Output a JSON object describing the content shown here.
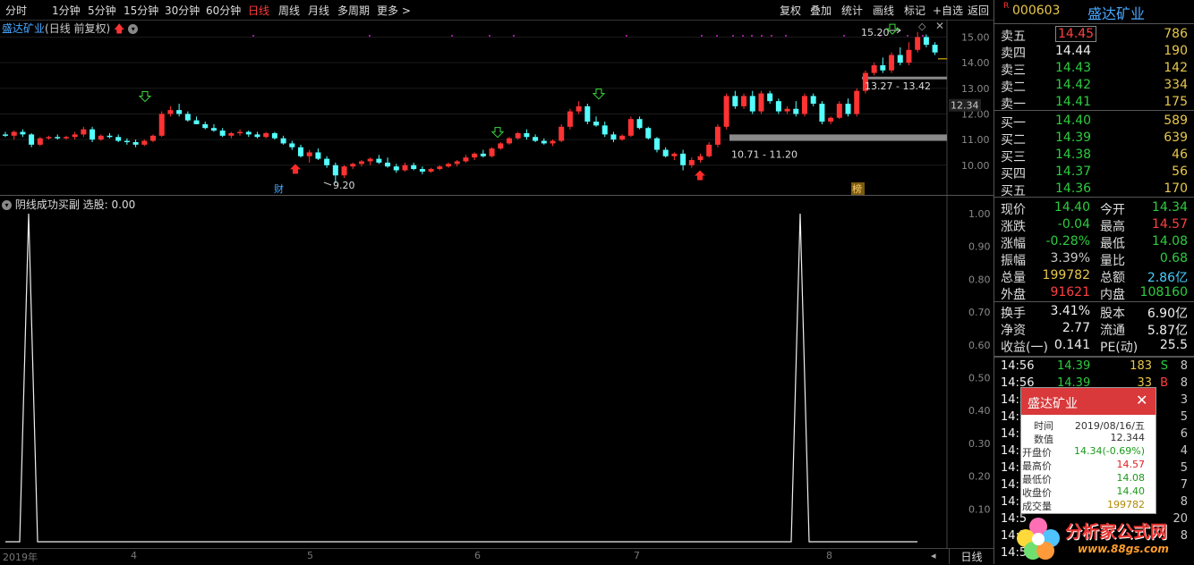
{
  "toolbar": {
    "items": [
      "分时",
      "1分钟",
      "5分钟",
      "15分钟",
      "30分钟",
      "60分钟",
      "日线",
      "周线",
      "月线",
      "多周期",
      "更多 >"
    ],
    "active": "日线",
    "right_items": [
      "复权",
      "叠加",
      "统计",
      "画线",
      "标记",
      "+自选",
      "返回"
    ]
  },
  "main_chart": {
    "title": "盛达矿业",
    "subtitle": "(日线 前复权)",
    "price_axis": [
      "15.00",
      "14.00",
      "13.00",
      "12.00",
      "11.00",
      "10.00"
    ],
    "current_price_tag": "12.34",
    "annotations": {
      "high_label": "15.20",
      "low_label": "9.20",
      "zone_upper": "13.27 - 13.42",
      "zone_lower": "10.71 - 11.20",
      "finance_mark": "财",
      "rank_mark": "榜"
    },
    "candles": [
      [
        11.2,
        11.3,
        11.1,
        11.15
      ],
      [
        11.15,
        11.35,
        11.0,
        11.3
      ],
      [
        11.3,
        11.4,
        11.1,
        11.2
      ],
      [
        11.2,
        11.25,
        10.7,
        10.8
      ],
      [
        10.8,
        11.1,
        10.75,
        11.05
      ],
      [
        11.05,
        11.15,
        11.0,
        11.1
      ],
      [
        11.1,
        11.2,
        11.0,
        11.05
      ],
      [
        11.05,
        11.15,
        11.0,
        11.1
      ],
      [
        11.1,
        11.3,
        11.0,
        11.2
      ],
      [
        11.2,
        11.5,
        11.1,
        11.4
      ],
      [
        11.4,
        11.5,
        10.9,
        11.0
      ],
      [
        11.0,
        11.2,
        10.95,
        11.15
      ],
      [
        11.15,
        11.25,
        11.05,
        11.1
      ],
      [
        11.1,
        11.2,
        10.9,
        10.95
      ],
      [
        10.95,
        11.05,
        10.8,
        10.9
      ],
      [
        10.9,
        11.0,
        10.7,
        10.8
      ],
      [
        10.8,
        11.0,
        10.75,
        10.95
      ],
      [
        10.95,
        11.2,
        10.9,
        11.15
      ],
      [
        11.15,
        12.1,
        11.1,
        12.0
      ],
      [
        12.0,
        12.3,
        11.9,
        12.15
      ],
      [
        12.15,
        12.4,
        11.9,
        12.0
      ],
      [
        12.0,
        12.1,
        11.7,
        11.75
      ],
      [
        11.75,
        11.9,
        11.6,
        11.6
      ],
      [
        11.6,
        11.7,
        11.4,
        11.45
      ],
      [
        11.45,
        11.6,
        11.3,
        11.35
      ],
      [
        11.35,
        11.45,
        11.1,
        11.15
      ],
      [
        11.15,
        11.3,
        11.05,
        11.25
      ],
      [
        11.25,
        11.4,
        11.15,
        11.3
      ],
      [
        11.3,
        11.35,
        11.1,
        11.2
      ],
      [
        11.2,
        11.3,
        11.05,
        11.1
      ],
      [
        11.1,
        11.3,
        11.05,
        11.25
      ],
      [
        11.25,
        11.3,
        11.0,
        11.05
      ],
      [
        11.05,
        11.15,
        10.8,
        10.85
      ],
      [
        10.85,
        10.95,
        10.6,
        10.7
      ],
      [
        10.7,
        10.8,
        10.3,
        10.35
      ],
      [
        10.35,
        10.6,
        10.1,
        10.5
      ],
      [
        10.5,
        10.65,
        10.2,
        10.25
      ],
      [
        10.25,
        10.35,
        9.9,
        10.0
      ],
      [
        10.0,
        10.1,
        9.3,
        9.6
      ],
      [
        9.6,
        10.0,
        9.5,
        9.95
      ],
      [
        9.95,
        10.1,
        9.85,
        10.05
      ],
      [
        10.05,
        10.2,
        9.95,
        10.15
      ],
      [
        10.15,
        10.3,
        10.0,
        10.25
      ],
      [
        10.25,
        10.4,
        10.05,
        10.1
      ],
      [
        10.1,
        10.3,
        9.9,
        9.95
      ],
      [
        9.95,
        10.05,
        9.7,
        9.8
      ],
      [
        9.8,
        10.1,
        9.75,
        10.0
      ],
      [
        10.0,
        10.1,
        9.8,
        9.85
      ],
      [
        9.85,
        9.95,
        9.65,
        9.75
      ],
      [
        9.75,
        9.9,
        9.7,
        9.85
      ],
      [
        9.85,
        10.0,
        9.8,
        9.95
      ],
      [
        9.95,
        10.1,
        9.9,
        10.05
      ],
      [
        10.05,
        10.2,
        9.95,
        10.15
      ],
      [
        10.15,
        10.4,
        10.1,
        10.3
      ],
      [
        10.3,
        10.5,
        10.2,
        10.45
      ],
      [
        10.45,
        10.6,
        10.3,
        10.35
      ],
      [
        10.35,
        10.7,
        10.3,
        10.65
      ],
      [
        10.65,
        10.9,
        10.6,
        10.85
      ],
      [
        10.85,
        11.1,
        10.8,
        11.05
      ],
      [
        11.05,
        11.3,
        11.0,
        11.25
      ],
      [
        11.25,
        11.4,
        11.0,
        11.1
      ],
      [
        11.1,
        11.2,
        10.9,
        10.95
      ],
      [
        10.95,
        11.05,
        10.8,
        10.85
      ],
      [
        10.85,
        11.0,
        10.75,
        10.95
      ],
      [
        10.95,
        11.6,
        10.9,
        11.5
      ],
      [
        11.5,
        12.2,
        11.4,
        12.1
      ],
      [
        12.1,
        12.5,
        12.0,
        12.3
      ],
      [
        12.3,
        12.4,
        11.6,
        11.7
      ],
      [
        11.7,
        11.9,
        11.5,
        11.55
      ],
      [
        11.55,
        11.7,
        11.1,
        11.2
      ],
      [
        11.2,
        11.3,
        10.9,
        11.0
      ],
      [
        11.0,
        11.2,
        10.95,
        11.15
      ],
      [
        11.15,
        11.9,
        11.1,
        11.8
      ],
      [
        11.8,
        11.9,
        11.4,
        11.45
      ],
      [
        11.45,
        11.5,
        11.0,
        11.05
      ],
      [
        11.05,
        11.1,
        10.5,
        10.6
      ],
      [
        10.6,
        10.7,
        10.3,
        10.35
      ],
      [
        10.35,
        10.5,
        10.2,
        10.45
      ],
      [
        10.45,
        10.6,
        9.8,
        10.0
      ],
      [
        10.0,
        10.3,
        9.9,
        10.2
      ],
      [
        10.2,
        10.45,
        10.1,
        10.35
      ],
      [
        10.35,
        10.9,
        10.3,
        10.8
      ],
      [
        10.8,
        11.6,
        10.7,
        11.5
      ],
      [
        11.5,
        12.8,
        11.4,
        12.7
      ],
      [
        12.7,
        12.9,
        12.2,
        12.3
      ],
      [
        12.3,
        12.8,
        12.2,
        12.7
      ],
      [
        12.7,
        12.9,
        12.0,
        12.1
      ],
      [
        12.1,
        12.9,
        12.0,
        12.8
      ],
      [
        12.8,
        12.9,
        12.4,
        12.5
      ],
      [
        12.5,
        12.6,
        12.0,
        12.1
      ],
      [
        12.1,
        12.3,
        12.0,
        12.2
      ],
      [
        12.2,
        12.5,
        11.9,
        12.0
      ],
      [
        12.0,
        12.8,
        11.9,
        12.7
      ],
      [
        12.7,
        12.8,
        12.3,
        12.4
      ],
      [
        12.4,
        12.5,
        11.6,
        11.7
      ],
      [
        11.7,
        11.9,
        11.6,
        11.85
      ],
      [
        11.85,
        12.5,
        11.8,
        12.4
      ],
      [
        12.4,
        12.6,
        11.9,
        12.0
      ],
      [
        12.0,
        13.0,
        11.9,
        12.9
      ],
      [
        12.9,
        13.7,
        12.8,
        13.6
      ],
      [
        13.6,
        14.0,
        13.5,
        13.9
      ],
      [
        13.9,
        14.2,
        13.6,
        13.7
      ],
      [
        13.7,
        14.4,
        13.6,
        14.3
      ],
      [
        14.3,
        14.6,
        13.9,
        14.0
      ],
      [
        14.0,
        14.8,
        13.9,
        14.5
      ],
      [
        14.5,
        15.2,
        14.4,
        15.0
      ],
      [
        15.0,
        15.1,
        14.6,
        14.7
      ],
      [
        14.7,
        14.8,
        14.3,
        14.4
      ]
    ]
  },
  "indicator": {
    "title": "阴线成功买副",
    "select_label": "选股: 0.00",
    "axis": [
      "1.00",
      "0.90",
      "0.80",
      "0.70",
      "0.60",
      "0.50",
      "0.40",
      "0.30",
      "0.20",
      "0.10"
    ],
    "signals": [
      {
        "index": 4,
        "value": 1.0
      },
      {
        "index": 117,
        "value": 1.0
      }
    ]
  },
  "bottom_axis": {
    "labels": [
      "2019年",
      "4",
      "5",
      "6",
      "7",
      "8"
    ],
    "period_button": "日线"
  },
  "quote_panel": {
    "code": "000603",
    "name": "盛达矿业",
    "flag": "R",
    "sell": [
      {
        "label": "卖五",
        "price": "14.45",
        "vol": "786"
      },
      {
        "label": "卖四",
        "price": "14.44",
        "vol": "190"
      },
      {
        "label": "卖三",
        "price": "14.43",
        "vol": "142"
      },
      {
        "label": "卖二",
        "price": "14.42",
        "vol": "334"
      },
      {
        "label": "卖一",
        "price": "14.41",
        "vol": "175"
      }
    ],
    "buy": [
      {
        "label": "买一",
        "price": "14.40",
        "vol": "589"
      },
      {
        "label": "买二",
        "price": "14.39",
        "vol": "639"
      },
      {
        "label": "买三",
        "price": "14.38",
        "vol": "46"
      },
      {
        "label": "买四",
        "price": "14.37",
        "vol": "56"
      },
      {
        "label": "买五",
        "price": "14.36",
        "vol": "170"
      }
    ],
    "stats": [
      {
        "l1": "现价",
        "v1": "14.40",
        "c1": "green",
        "l2": "今开",
        "v2": "14.34",
        "c2": "green"
      },
      {
        "l1": "涨跌",
        "v1": "-0.04",
        "c1": "green",
        "l2": "最高",
        "v2": "14.57",
        "c2": "red"
      },
      {
        "l1": "涨幅",
        "v1": "-0.28%",
        "c1": "green",
        "l2": "最低",
        "v2": "14.08",
        "c2": "green"
      },
      {
        "l1": "振幅",
        "v1": "3.39%",
        "c1": "gray",
        "l2": "量比",
        "v2": "0.68",
        "c2": "green"
      },
      {
        "l1": "总量",
        "v1": "199782",
        "c1": "yellow",
        "l2": "总额",
        "v2": "2.86亿",
        "c2": "cyan"
      },
      {
        "l1": "外盘",
        "v1": "91621",
        "c1": "red",
        "l2": "内盘",
        "v2": "108160",
        "c2": "green"
      }
    ],
    "fundamentals": [
      {
        "l1": "换手",
        "v1": "3.41%",
        "l2": "股本",
        "v2": "6.90亿"
      },
      {
        "l1": "净资",
        "v1": "2.77",
        "l2": "流通",
        "v2": "5.87亿"
      },
      {
        "l1": "收益(一)",
        "v1": "0.141",
        "l2": "PE(动)",
        "v2": "25.5"
      }
    ],
    "ticks": [
      {
        "time": "14:56",
        "price": "14.39",
        "vol": "183",
        "side": "S",
        "n": "8"
      },
      {
        "time": "14:56",
        "price": "14.39",
        "vol": "33",
        "side": "B",
        "n": "8"
      },
      {
        "time": "14:5",
        "price": "",
        "vol": "",
        "side": "",
        "n": "3"
      },
      {
        "time": "14:5",
        "price": "",
        "vol": "",
        "side": "",
        "n": "5"
      },
      {
        "time": "14:5",
        "price": "",
        "vol": "",
        "side": "",
        "n": "6"
      },
      {
        "time": "14:5",
        "price": "",
        "vol": "",
        "side": "",
        "n": "4"
      },
      {
        "time": "14:5",
        "price": "",
        "vol": "",
        "side": "",
        "n": "5"
      },
      {
        "time": "14:5",
        "price": "",
        "vol": "",
        "side": "",
        "n": "7"
      },
      {
        "time": "14:5",
        "price": "",
        "vol": "",
        "side": "",
        "n": "8"
      },
      {
        "time": "14:5",
        "price": "",
        "vol": "",
        "side": "",
        "n": "20"
      },
      {
        "time": "14:5",
        "price": "",
        "vol": "",
        "side": "",
        "n": "8"
      },
      {
        "time": "14:5",
        "price": "",
        "vol": "",
        "side": "",
        "n": ""
      }
    ]
  },
  "popup": {
    "title": "盛达矿业",
    "rows": [
      {
        "label": "时间",
        "value": "2019/08/16/五",
        "color": "#333"
      },
      {
        "label": "数值",
        "value": "12.344",
        "color": "#333"
      },
      {
        "label": "开盘价",
        "value": "14.34(-0.69%)",
        "color": "#1a9a1a"
      },
      {
        "label": "最高价",
        "value": "14.57",
        "color": "#e02020"
      },
      {
        "label": "最低价",
        "value": "14.08",
        "color": "#1a9a1a"
      },
      {
        "label": "收盘价",
        "value": "14.40",
        "color": "#1a9a1a"
      },
      {
        "label": "成交量",
        "value": "199782",
        "color": "#b08a00"
      }
    ]
  },
  "watermark": {
    "text": "分析家公式网",
    "url": "www.88gs.com"
  },
  "colors": {
    "up": "#ff3333",
    "down": "#54ffff",
    "accent": "#ff3333",
    "gridline": "#2a2a2a"
  }
}
